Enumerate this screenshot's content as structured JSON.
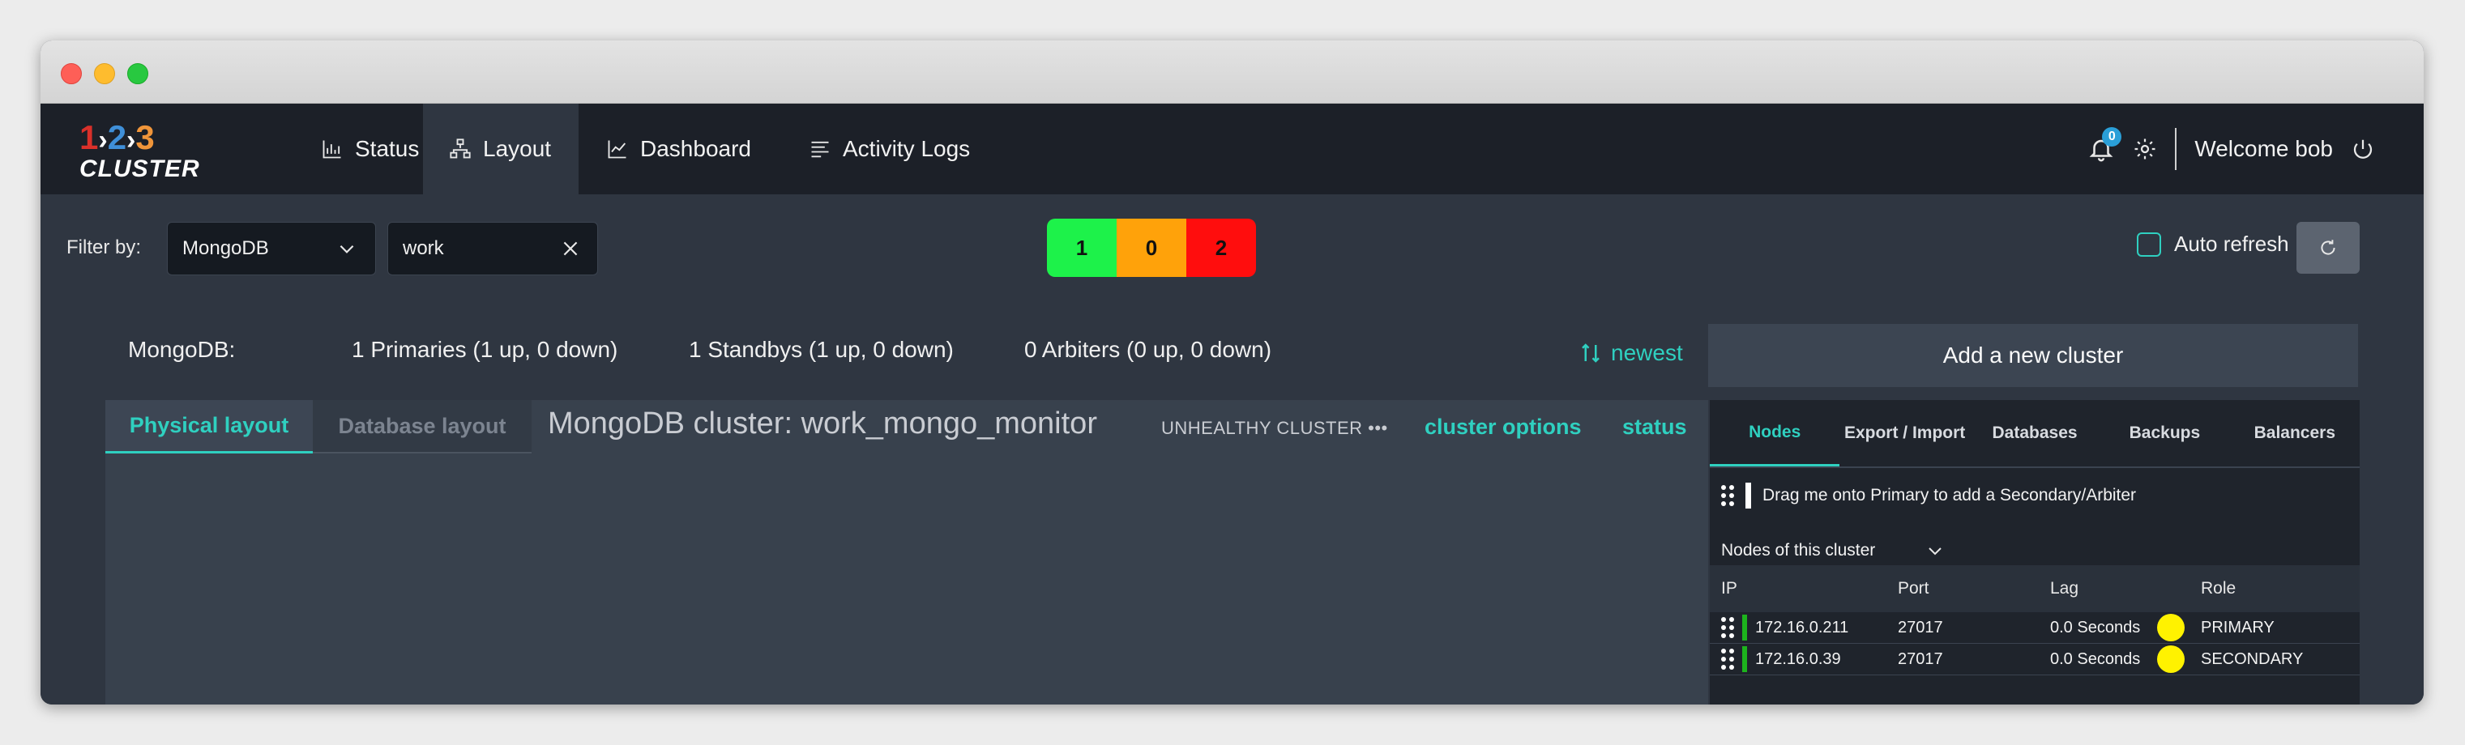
{
  "app": {
    "logo": {
      "numbers": [
        "1",
        "2",
        "3"
      ],
      "word": "CLUSTER"
    },
    "nav": [
      {
        "label": "Status",
        "icon": "bar-chart-icon"
      },
      {
        "label": "Layout",
        "icon": "sitemap-icon",
        "active": true
      },
      {
        "label": "Dashboard",
        "icon": "line-chart-icon"
      },
      {
        "label": "Activity Logs",
        "icon": "list-icon"
      }
    ],
    "notifications_count": "0",
    "welcome": "Welcome bob"
  },
  "filter": {
    "label": "Filter by:",
    "db_type": "MongoDB",
    "search_value": "work"
  },
  "counts": {
    "up": "1",
    "warning": "0",
    "down": "2"
  },
  "auto_refresh": {
    "label": "Auto refresh",
    "checked": false
  },
  "summary": {
    "db": "MongoDB:",
    "primaries": "1 Primaries (1 up, 0 down)",
    "standbys": "1 Standbys (1 up, 0 down)",
    "arbiters": "0 Arbiters (0 up, 0 down)"
  },
  "sort": {
    "label": "newest"
  },
  "add_cluster": "Add a new cluster",
  "layout_tabs": {
    "physical": "Physical layout",
    "database": "Database layout"
  },
  "cluster": {
    "title": "MongoDB cluster: work_mongo_monitor",
    "state": "UNHEALTHY CLUSTER",
    "options": "cluster options",
    "status": "status"
  },
  "side": {
    "tabs": [
      "Nodes",
      "Export / Import",
      "Databases",
      "Backups",
      "Balancers"
    ],
    "drag_hint": "Drag me onto Primary to add a Secondary/Arbiter",
    "nodes_label": "Nodes of this cluster",
    "columns": {
      "ip": "IP",
      "port": "Port",
      "lag": "Lag",
      "role": "Role"
    },
    "rows": [
      {
        "ip": "172.16.0.211",
        "port": "27017",
        "lag": "0.0 Seconds",
        "role": "PRIMARY"
      },
      {
        "ip": "172.16.0.39",
        "port": "27017",
        "lag": "0.0 Seconds",
        "role": "SECONDARY"
      }
    ]
  },
  "colors": {
    "accent": "#2fd0c0",
    "up": "#1df24a",
    "warning": "#ffa20a",
    "down": "#ff0d0d"
  }
}
